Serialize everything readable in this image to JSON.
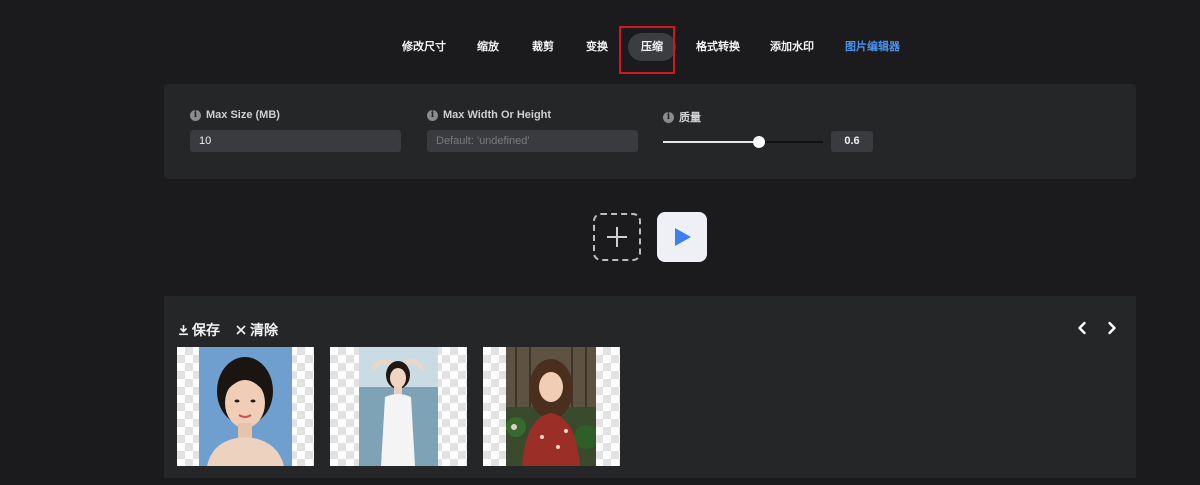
{
  "tabs": [
    {
      "label": "修改尺寸"
    },
    {
      "label": "缩放"
    },
    {
      "label": "裁剪"
    },
    {
      "label": "变换"
    },
    {
      "label": "压缩"
    },
    {
      "label": "格式转换"
    },
    {
      "label": "添加水印"
    },
    {
      "label": "图片编辑器"
    }
  ],
  "active_tab": "压缩",
  "options": {
    "max_size": {
      "label": "Max Size (MB)",
      "value": "10",
      "info_icon": "i"
    },
    "max_dim": {
      "label": "Max Width Or Height",
      "placeholder": "Default: 'undefined'",
      "info_icon": "i"
    },
    "quality": {
      "label": "质量",
      "value": "0.6",
      "info_icon": "i"
    }
  },
  "results": {
    "save_label": "保存",
    "clear_label": "清除",
    "thumbnails": [
      "portrait-woman-blue-background",
      "woman-by-lake",
      "woman-in-garden"
    ]
  },
  "colors": {
    "accent_link": "#4a90e8",
    "highlight": "#d4151b",
    "play": "#3b7ff0"
  }
}
